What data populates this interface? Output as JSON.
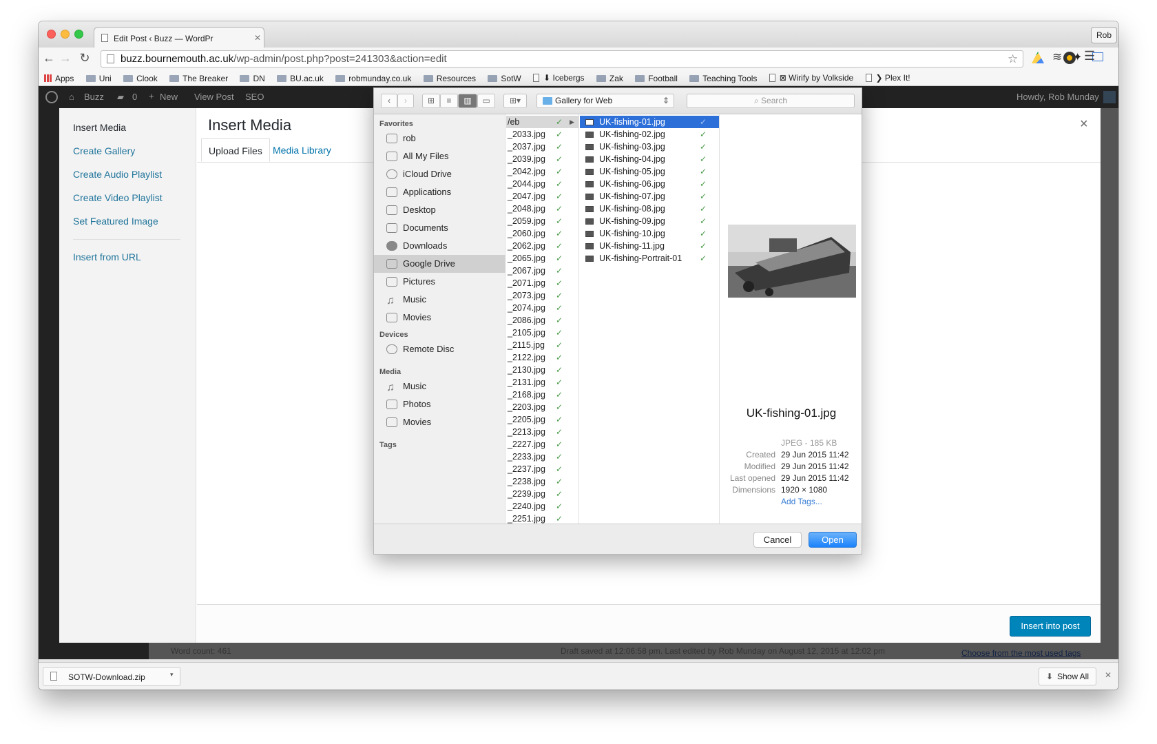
{
  "browser": {
    "tab_title": "Edit Post ‹ Buzz — WordPr",
    "profile": "Rob",
    "url_host": "buzz.bournemouth.ac.uk",
    "url_path": "/wp-admin/post.php?post=241303&action=edit",
    "bookmarks": [
      "Apps",
      "Uni",
      "Clook",
      "The Breaker",
      "DN",
      "BU.ac.uk",
      "robmunday.co.uk",
      "Resources",
      "SotW",
      "⬇ Icebergs",
      "Zak",
      "Football",
      "Teaching Tools",
      "⊠ Wirify by Volkside",
      "❯ Plex It!"
    ]
  },
  "wp_admin_bar": {
    "site": "Buzz",
    "comments": "0",
    "new": "New",
    "view_post": "View Post",
    "seo": "SEO",
    "howdy": "Howdy, Rob Munday"
  },
  "media_modal": {
    "sidebar": [
      "Insert Media",
      "Create Gallery",
      "Create Audio Playlist",
      "Create Video Playlist",
      "Set Featured Image",
      "Insert from URL"
    ],
    "title": "Insert Media",
    "tabs": [
      "Upload Files",
      "Media Library"
    ],
    "close": "×",
    "insert_button": "Insert into post"
  },
  "wp_footer": {
    "word_count": "Word count: 461",
    "draft": "Draft saved at 12:06:58 pm. Last edited by Rob Munday on August 12, 2015 at 12:02 pm",
    "tags_link": "Choose from the most used tags"
  },
  "download_bar": {
    "file": "SOTW-Download.zip",
    "show_all": "Show All"
  },
  "file_dialog": {
    "folder": "Gallery for Web",
    "search_placeholder": "Search",
    "sidebar": {
      "favorites_label": "Favorites",
      "favorites": [
        "rob",
        "All My Files",
        "iCloud Drive",
        "Applications",
        "Desktop",
        "Documents",
        "Downloads",
        "Google Drive",
        "Pictures",
        "Music",
        "Movies"
      ],
      "devices_label": "Devices",
      "devices": [
        "Remote Disc"
      ],
      "media_label": "Media",
      "media": [
        "Music",
        "Photos",
        "Movies"
      ],
      "tags_label": "Tags"
    },
    "column1_header": "/eb",
    "column1": [
      "_2033.jpg",
      "_2037.jpg",
      "_2039.jpg",
      "_2042.jpg",
      "_2044.jpg",
      "_2047.jpg",
      "_2048.jpg",
      "_2059.jpg",
      "_2060.jpg",
      "_2062.jpg",
      "_2065.jpg",
      "_2067.jpg",
      "_2071.jpg",
      "_2073.jpg",
      "_2074.jpg",
      "_2086.jpg",
      "_2105.jpg",
      "_2115.jpg",
      "_2122.jpg",
      "_2130.jpg",
      "_2131.jpg",
      "_2168.jpg",
      "_2203.jpg",
      "_2205.jpg",
      "_2213.jpg",
      "_2227.jpg",
      "_2233.jpg",
      "_2237.jpg",
      "_2238.jpg",
      "_2239.jpg",
      "_2240.jpg",
      "_2251.jpg"
    ],
    "column2": [
      "UK-fishing-01.jpg",
      "UK-fishing-02.jpg",
      "UK-fishing-03.jpg",
      "UK-fishing-04.jpg",
      "UK-fishing-05.jpg",
      "UK-fishing-06.jpg",
      "UK-fishing-07.jpg",
      "UK-fishing-08.jpg",
      "UK-fishing-09.jpg",
      "UK-fishing-10.jpg",
      "UK-fishing-11.jpg",
      "UK-fishing-Portrait-01"
    ],
    "preview": {
      "name": "UK-fishing-01.jpg",
      "kind": "JPEG - 185 KB",
      "labels": [
        "Created",
        "Modified",
        "Last opened",
        "Dimensions"
      ],
      "values": [
        "29 Jun 2015 11:42",
        "29 Jun 2015 11:42",
        "29 Jun 2015 11:42",
        "1920 × 1080"
      ],
      "add_tags": "Add Tags..."
    },
    "cancel": "Cancel",
    "open": "Open"
  }
}
